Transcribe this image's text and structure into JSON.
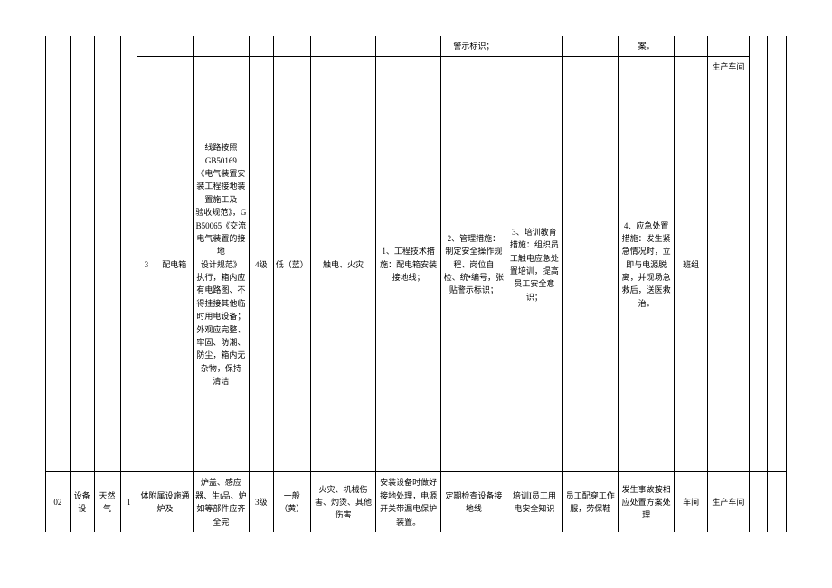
{
  "row0": {
    "c11": "警示标识；",
    "c14": "案。"
  },
  "row1": {
    "c4": "3",
    "c5": "配电箱",
    "c6": "线路按照\nGB50169\n《电气装置安装工程接地装置施工及\n验收规范》，GB50065《交流电气装置的接地\n设计规范》\n执行，箱内应有电路图、不得挂接其他临时用电设备；外观应完整、牢固、防潮、防尘，箱内无杂物，保持\n清洁",
    "c7": "4级",
    "c8": "低（蓝）",
    "c9": "触电、火灾",
    "c10": "1、工程技术措施：配电箱安装接地线；",
    "c11": "2、管理措施：制定安全操作规程、岗位自\n检、统•编号，张贴警示标识；",
    "c12": "3、培训教育措施：组织员工触电应急处置培训，提高员工安全意识；",
    "c14": "4、应急处置措施：发生紧急情况时，立即与电源脱离，并现场急救后，送医救治。",
    "c15": "班组",
    "c16": "生产车间"
  },
  "row2": {
    "c0": "02",
    "c1": "设备设",
    "c2": "天然气",
    "c3": "1",
    "c4": "体附属设施通炉及",
    "c5": "炉盖、感应器、生t品、炉如等部件应齐全完",
    "c6": "3级",
    "c7": "一般（黄）",
    "c8": "火灾、机械伤害、灼烫、其他伤害",
    "c9": "安装设备时做好接地处理，电源开关带漏电保护装置。",
    "c10": "定期检查设备接地线",
    "c11": "培训I员工用电安全知识",
    "c12": "员工配穿工作服，劳保鞋",
    "c13": "发生事故按相应处置方案处理",
    "c14": "车间",
    "c15": "生产车间"
  }
}
